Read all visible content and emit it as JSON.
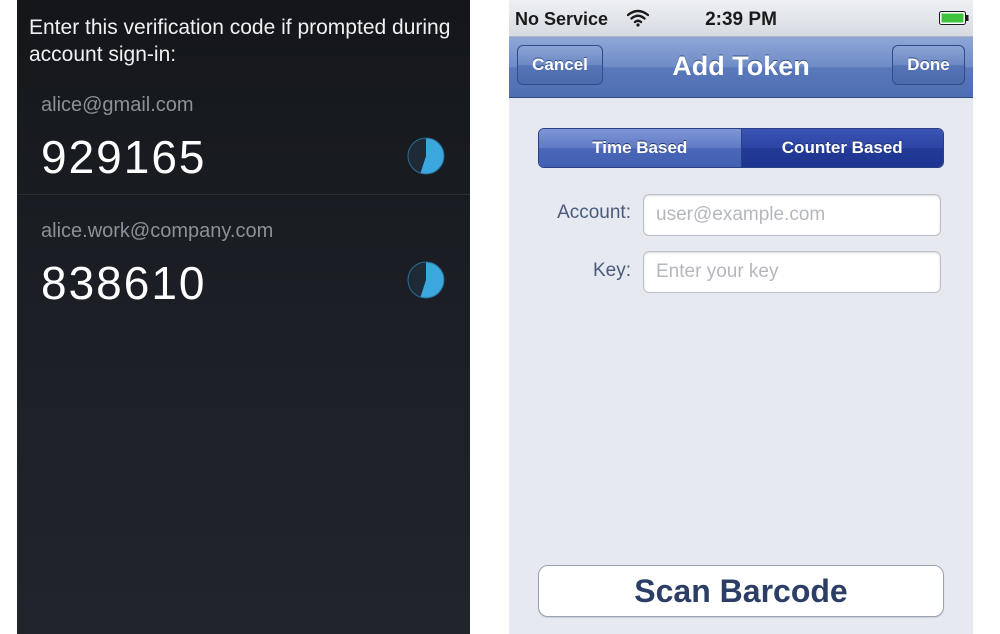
{
  "android": {
    "header": "Enter this verification code if prompted during account sign-in:",
    "accounts": [
      {
        "email": "alice@gmail.com",
        "code": "929165",
        "timer_remaining_fraction": 0.55
      },
      {
        "email": "alice.work@company.com",
        "code": "838610",
        "timer_remaining_fraction": 0.55
      }
    ],
    "colors": {
      "timer_fill": "#3aa8df",
      "timer_empty": "#1e2a35"
    }
  },
  "ios": {
    "status": {
      "carrier": "No Service",
      "time": "2:39 PM"
    },
    "nav": {
      "title": "Add Token",
      "cancel": "Cancel",
      "done": "Done"
    },
    "segments": {
      "time_based": "Time Based",
      "counter_based": "Counter Based",
      "selected": "Counter Based"
    },
    "account_field": {
      "label": "Account:",
      "placeholder": "user@example.com",
      "value": ""
    },
    "key_field": {
      "label": "Key:",
      "placeholder": "Enter your key",
      "value": ""
    },
    "scan_button": "Scan Barcode",
    "colors": {
      "nav_bar": "#5a79bb",
      "segment_selected": "#223a96",
      "battery": "#3ec33e"
    }
  }
}
